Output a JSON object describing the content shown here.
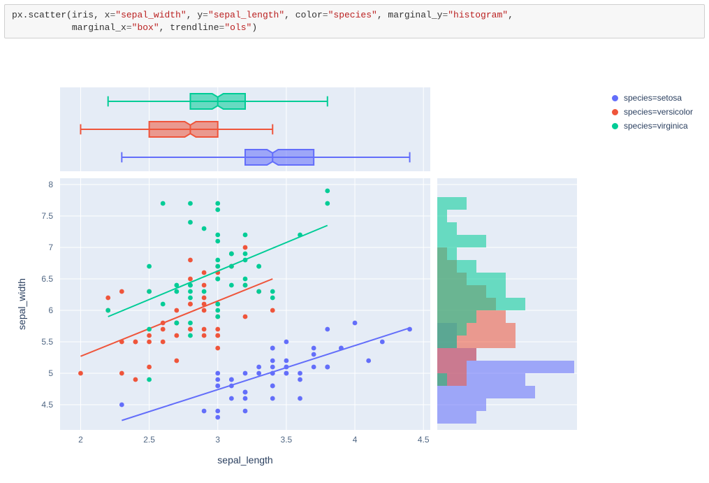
{
  "code": {
    "fn": "px.scatter",
    "id": "iris",
    "kw_x": "x",
    "val_x": "\"sepal_width\"",
    "kw_y": "y",
    "val_y": "\"sepal_length\"",
    "kw_color": "color",
    "val_color": "\"species\"",
    "kw_my": "marginal_y",
    "val_my": "\"histogram\"",
    "kw_mx": "marginal_x",
    "val_mx": "\"box\"",
    "kw_tr": "trendline",
    "val_tr": "\"ols\""
  },
  "legend": {
    "setosa": {
      "label": "species=setosa",
      "color": "#636efa"
    },
    "versicolor": {
      "label": "species=versicolor",
      "color": "#ef553b"
    },
    "virginica": {
      "label": "species=virginica",
      "color": "#00cc96"
    }
  },
  "axes": {
    "xlabel": "sepal_length",
    "ylabel": "sepal_width",
    "xticks": [
      "2",
      "2.5",
      "3",
      "3.5",
      "4",
      "4.5"
    ],
    "yticks": [
      "4.5",
      "5",
      "5.5",
      "6",
      "6.5",
      "7",
      "7.5",
      "8"
    ]
  },
  "chart_data": {
    "type": "scatter",
    "x_field": "sepal_width",
    "y_field": "sepal_length",
    "color_field": "species",
    "xlim": [
      1.85,
      4.55
    ],
    "ylim": [
      4.1,
      8.1
    ],
    "marginal_x": "box",
    "marginal_y": "histogram",
    "trendline": "ols",
    "colors": {
      "setosa": "#636efa",
      "versicolor": "#ef553b",
      "virginica": "#00cc96"
    },
    "series": [
      {
        "name": "setosa",
        "points": [
          [
            3.5,
            5.1
          ],
          [
            3.0,
            4.9
          ],
          [
            3.2,
            4.7
          ],
          [
            3.1,
            4.6
          ],
          [
            3.6,
            5.0
          ],
          [
            3.9,
            5.4
          ],
          [
            3.4,
            4.6
          ],
          [
            3.4,
            5.0
          ],
          [
            2.9,
            4.4
          ],
          [
            3.1,
            4.9
          ],
          [
            3.7,
            5.4
          ],
          [
            3.4,
            4.8
          ],
          [
            3.0,
            4.8
          ],
          [
            3.0,
            4.3
          ],
          [
            4.0,
            5.8
          ],
          [
            4.4,
            5.7
          ],
          [
            3.9,
            5.4
          ],
          [
            3.5,
            5.1
          ],
          [
            3.8,
            5.7
          ],
          [
            3.8,
            5.1
          ],
          [
            3.4,
            5.4
          ],
          [
            3.7,
            5.1
          ],
          [
            3.6,
            4.6
          ],
          [
            3.3,
            5.1
          ],
          [
            3.4,
            4.8
          ],
          [
            3.0,
            5.0
          ],
          [
            3.4,
            5.0
          ],
          [
            3.5,
            5.2
          ],
          [
            3.4,
            5.2
          ],
          [
            3.2,
            4.7
          ],
          [
            3.1,
            4.8
          ],
          [
            3.4,
            5.4
          ],
          [
            4.1,
            5.2
          ],
          [
            4.2,
            5.5
          ],
          [
            3.1,
            4.9
          ],
          [
            3.2,
            5.0
          ],
          [
            3.5,
            5.5
          ],
          [
            3.6,
            4.9
          ],
          [
            3.0,
            4.4
          ],
          [
            3.4,
            5.1
          ],
          [
            3.5,
            5.0
          ],
          [
            2.3,
            4.5
          ],
          [
            3.2,
            4.4
          ],
          [
            3.5,
            5.0
          ],
          [
            3.8,
            5.1
          ],
          [
            3.0,
            4.8
          ],
          [
            3.8,
            5.1
          ],
          [
            3.2,
            4.6
          ],
          [
            3.7,
            5.3
          ],
          [
            3.3,
            5.0
          ]
        ],
        "box": {
          "min": 2.3,
          "q1": 3.2,
          "median": 3.4,
          "q3": 3.7,
          "max": 4.4
        },
        "hist": {
          "bin_start": 4.2,
          "bin_width": 0.2,
          "counts": [
            4,
            5,
            10,
            9,
            14,
            4,
            2,
            2
          ]
        },
        "trend": {
          "x0": 2.3,
          "y0": 4.25,
          "x1": 4.4,
          "y1": 5.72
        }
      },
      {
        "name": "versicolor",
        "points": [
          [
            3.2,
            7.0
          ],
          [
            3.2,
            6.4
          ],
          [
            3.1,
            6.9
          ],
          [
            2.3,
            5.5
          ],
          [
            2.8,
            6.5
          ],
          [
            2.8,
            5.7
          ],
          [
            3.3,
            6.3
          ],
          [
            2.4,
            4.9
          ],
          [
            2.9,
            6.6
          ],
          [
            2.7,
            5.2
          ],
          [
            2.0,
            5.0
          ],
          [
            3.0,
            5.9
          ],
          [
            2.2,
            6.0
          ],
          [
            2.9,
            6.1
          ],
          [
            2.9,
            5.6
          ],
          [
            3.1,
            6.7
          ],
          [
            3.0,
            5.6
          ],
          [
            2.7,
            5.8
          ],
          [
            2.2,
            6.2
          ],
          [
            2.5,
            5.6
          ],
          [
            3.2,
            5.9
          ],
          [
            2.8,
            6.1
          ],
          [
            2.5,
            6.3
          ],
          [
            2.8,
            6.1
          ],
          [
            2.9,
            6.4
          ],
          [
            3.0,
            6.6
          ],
          [
            2.8,
            6.8
          ],
          [
            3.0,
            6.7
          ],
          [
            2.9,
            6.0
          ],
          [
            2.6,
            5.7
          ],
          [
            2.4,
            5.5
          ],
          [
            2.4,
            5.5
          ],
          [
            2.7,
            5.8
          ],
          [
            2.7,
            6.0
          ],
          [
            3.0,
            5.4
          ],
          [
            3.4,
            6.0
          ],
          [
            3.1,
            6.7
          ],
          [
            2.3,
            6.3
          ],
          [
            3.0,
            5.6
          ],
          [
            2.5,
            5.5
          ],
          [
            2.6,
            5.5
          ],
          [
            3.0,
            6.1
          ],
          [
            2.6,
            5.8
          ],
          [
            2.3,
            5.0
          ],
          [
            2.7,
            5.6
          ],
          [
            3.0,
            5.7
          ],
          [
            2.9,
            5.7
          ],
          [
            2.9,
            6.2
          ],
          [
            2.5,
            5.1
          ],
          [
            2.8,
            5.7
          ]
        ],
        "box": {
          "min": 2.0,
          "q1": 2.5,
          "median": 2.8,
          "q3": 3.0,
          "max": 3.4
        },
        "hist": {
          "bin_start": 4.8,
          "bin_width": 0.2,
          "counts": [
            3,
            3,
            4,
            8,
            8,
            7,
            6,
            5,
            3,
            2,
            1
          ]
        },
        "trend": {
          "x0": 2.0,
          "y0": 5.27,
          "x1": 3.4,
          "y1": 6.5
        }
      },
      {
        "name": "virginica",
        "points": [
          [
            3.3,
            6.3
          ],
          [
            2.7,
            5.8
          ],
          [
            3.0,
            7.1
          ],
          [
            2.9,
            6.3
          ],
          [
            3.0,
            6.5
          ],
          [
            3.0,
            7.6
          ],
          [
            2.5,
            4.9
          ],
          [
            2.9,
            7.3
          ],
          [
            2.5,
            6.7
          ],
          [
            3.6,
            7.2
          ],
          [
            3.2,
            6.5
          ],
          [
            2.7,
            6.4
          ],
          [
            3.0,
            6.8
          ],
          [
            2.5,
            5.7
          ],
          [
            2.8,
            5.8
          ],
          [
            3.2,
            6.4
          ],
          [
            3.0,
            6.5
          ],
          [
            3.8,
            7.7
          ],
          [
            2.6,
            7.7
          ],
          [
            2.2,
            6.0
          ],
          [
            3.2,
            6.9
          ],
          [
            2.8,
            5.6
          ],
          [
            2.8,
            7.7
          ],
          [
            2.7,
            6.3
          ],
          [
            3.3,
            6.7
          ],
          [
            3.2,
            7.2
          ],
          [
            2.8,
            6.2
          ],
          [
            3.0,
            6.1
          ],
          [
            2.8,
            6.4
          ],
          [
            3.0,
            7.2
          ],
          [
            2.8,
            7.4
          ],
          [
            3.8,
            7.9
          ],
          [
            2.8,
            6.4
          ],
          [
            2.8,
            6.3
          ],
          [
            2.6,
            6.1
          ],
          [
            3.0,
            7.7
          ],
          [
            3.4,
            6.3
          ],
          [
            3.1,
            6.4
          ],
          [
            3.0,
            6.0
          ],
          [
            3.1,
            6.9
          ],
          [
            3.1,
            6.7
          ],
          [
            3.1,
            6.9
          ],
          [
            2.7,
            5.8
          ],
          [
            3.2,
            6.8
          ],
          [
            3.3,
            6.7
          ],
          [
            3.0,
            6.7
          ],
          [
            2.5,
            6.3
          ],
          [
            3.0,
            6.5
          ],
          [
            3.4,
            6.2
          ],
          [
            3.0,
            5.9
          ]
        ],
        "box": {
          "min": 2.2,
          "q1": 2.8,
          "median": 3.0,
          "q3": 3.2,
          "max": 3.8
        },
        "hist": {
          "bin_start": 4.8,
          "bin_width": 0.2,
          "counts": [
            1,
            0,
            0,
            2,
            3,
            4,
            9,
            7,
            7,
            4,
            2,
            5,
            2,
            1,
            3
          ]
        },
        "trend": {
          "x0": 2.2,
          "y1": 7.35,
          "y0": 5.9,
          "x1": 3.8
        }
      }
    ]
  }
}
